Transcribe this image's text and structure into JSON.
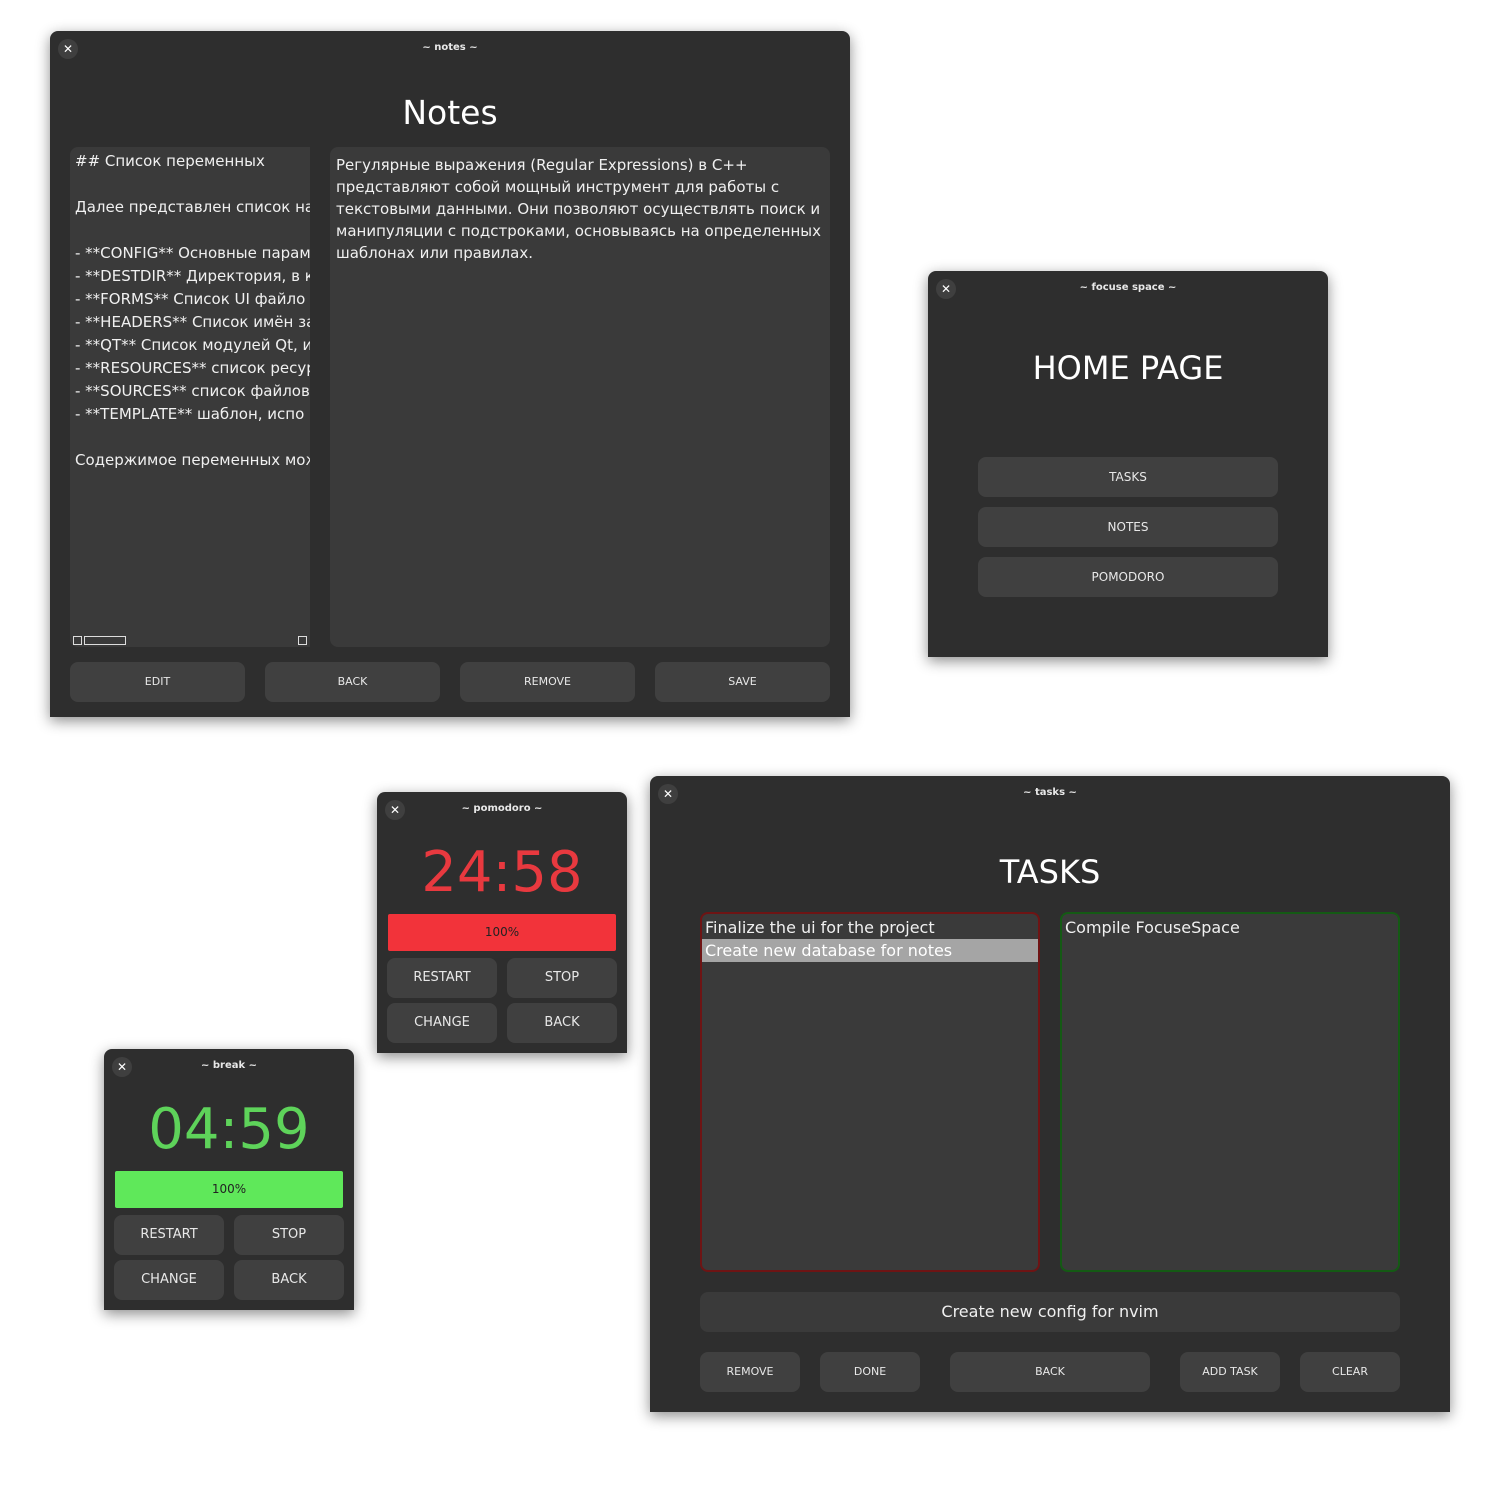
{
  "notes_window": {
    "title": "~ notes ~",
    "heading": "Notes",
    "list_lines": [
      "## Список переменных",
      "",
      "Далее представлен список на",
      "",
      "- **CONFIG** Основные парам",
      "- **DESTDIR** Директория, в к",
      "- **FORMS** Список UI файло",
      "- **HEADERS** Список имён за",
      "- **QT** Список модулей Qt, и",
      "- **RESOURCES** список ресур",
      "- **SOURCES** список файлов",
      "- **TEMPLATE** шаблон, испо",
      "",
      "Содержимое переменных мож"
    ],
    "content_text": "Регулярные выражения (Regular Expressions) в C++ представляют собой мощный инструмент для работы с текстовыми данными. Они позволяют осуществлять поиск и манипуляции с подстроками, основываясь на определенных шаблонах или правилах.",
    "buttons": {
      "edit": "EDIT",
      "back": "BACK",
      "remove": "REMOVE",
      "save": "SAVE"
    }
  },
  "home_window": {
    "title": "~ focuse space ~",
    "heading": "HOME PAGE",
    "buttons": {
      "tasks": "TASKS",
      "notes": "NOTES",
      "pomodoro": "POMODORO"
    }
  },
  "pomodoro_window": {
    "title": "~ pomodoro ~",
    "time": "24:58",
    "progress_label": "100%",
    "progress_value": 1.0,
    "colors": {
      "time": "#e8393f",
      "bar": "#f2333a"
    },
    "buttons": {
      "restart": "RESTART",
      "stop": "STOP",
      "change": "CHANGE",
      "back": "BACK"
    }
  },
  "break_window": {
    "title": "~ break ~",
    "time": "04:59",
    "progress_label": "100%",
    "progress_value": 1.0,
    "colors": {
      "time": "#5ed35a",
      "bar": "#5fe85a"
    },
    "buttons": {
      "restart": "RESTART",
      "stop": "STOP",
      "change": "CHANGE",
      "back": "BACK"
    }
  },
  "tasks_window": {
    "title": "~ tasks ~",
    "heading": "TASKS",
    "todo_items": [
      {
        "text": "Finalize the ui for the project",
        "selected": false
      },
      {
        "text": "Create new database for notes",
        "selected": true
      }
    ],
    "done_items": [
      {
        "text": "Compile FocuseSpace",
        "selected": false
      }
    ],
    "colors": {
      "todo_border": "#6e1414",
      "done_border": "#145a14"
    },
    "input_value": "Create new config for nvim",
    "buttons": {
      "remove": "REMOVE",
      "done": "DONE",
      "back": "BACK",
      "add_task": "ADD TASK",
      "clear": "CLEAR"
    }
  }
}
